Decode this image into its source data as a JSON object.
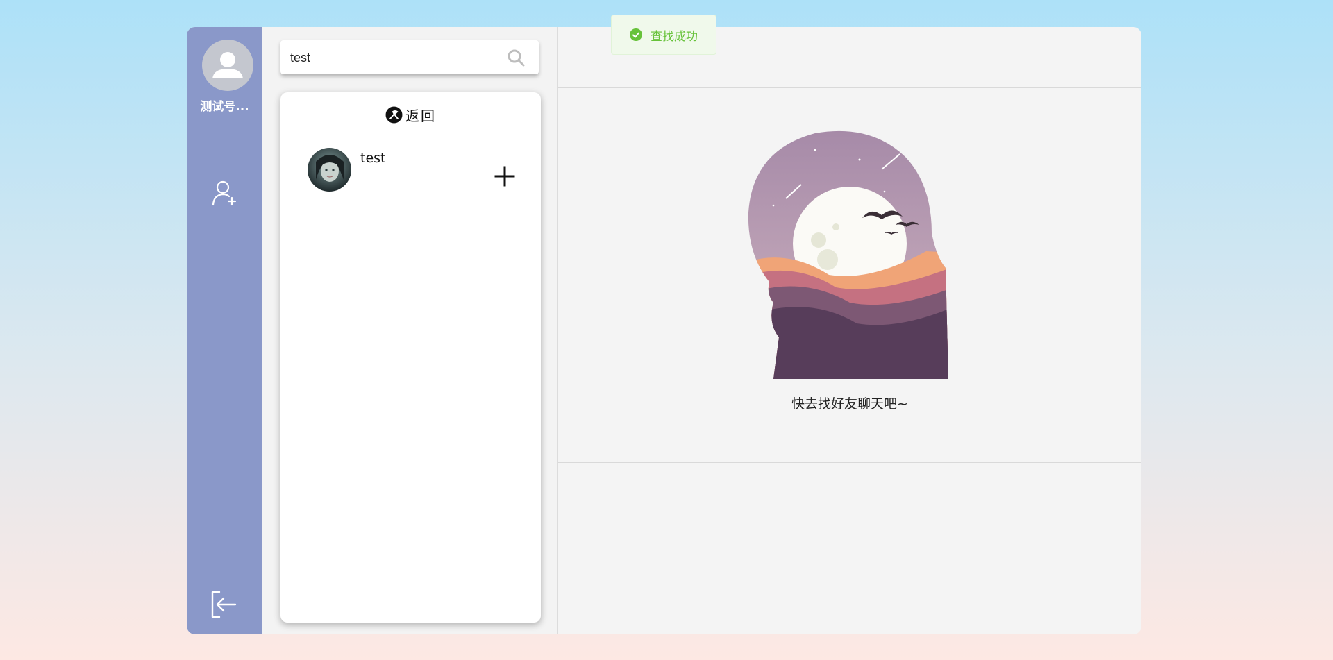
{
  "user": {
    "name": "测试号..."
  },
  "search": {
    "value": "test",
    "placeholder": ""
  },
  "results_panel": {
    "back_label": "返回",
    "items": [
      {
        "name": "test"
      }
    ]
  },
  "chat": {
    "empty_text": "快去找好友聊天吧~"
  },
  "toast": {
    "text": "查找成功",
    "type": "success"
  },
  "colors": {
    "sidebar": "#8a98c9",
    "toast_text": "#67c23a",
    "toast_bg": "#f0f9eb"
  },
  "icons": {
    "avatar": "user-silhouette-icon",
    "add_friend": "user-plus-icon",
    "logout": "logout-icon",
    "search": "search-icon",
    "back": "back-icon",
    "add": "plus-icon",
    "toast": "check-circle-icon"
  }
}
